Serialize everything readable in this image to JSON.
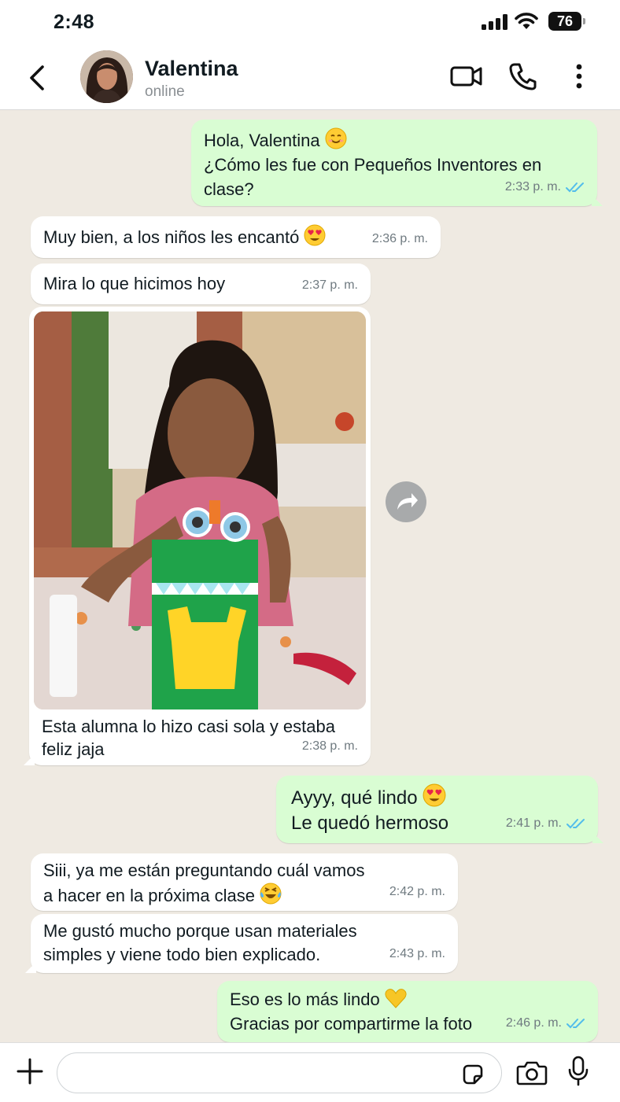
{
  "status_bar": {
    "time": "2:48",
    "battery": "76"
  },
  "header": {
    "contact_name": "Valentina",
    "contact_status": "online"
  },
  "messages": [
    {
      "from": "me",
      "lines": [
        "Hola, Valentina",
        "¿Cómo les fue con Pequeños Inventores en clase?"
      ],
      "time": "2:33 p. m.",
      "ticks": "read"
    },
    {
      "from": "contact",
      "lines": [
        "Muy bien, a los niños les encantó"
      ],
      "time": "2:36 p. m."
    },
    {
      "from": "contact",
      "lines": [
        "Mira lo que hicimos hoy"
      ],
      "time": "2:37 p. m."
    },
    {
      "from": "contact",
      "type": "image",
      "caption_lines": [
        "Esta alumna lo hizo casi sola y estaba",
        "feliz jaja"
      ],
      "time": "2:38 p. m."
    },
    {
      "from": "me",
      "lines": [
        "Ayyy, qué lindo",
        "Le quedó hermoso"
      ],
      "time": "2:41 p. m.",
      "ticks": "read"
    },
    {
      "from": "contact",
      "lines": [
        "Siii, ya me están preguntando cuál vamos",
        "a hacer en la próxima clase"
      ],
      "time": "2:42 p. m."
    },
    {
      "from": "contact",
      "lines": [
        "Me gustó mucho porque usan materiales",
        "simples y viene todo bien explicado."
      ],
      "time": "2:43 p. m."
    },
    {
      "from": "me",
      "lines": [
        "Eso es lo más lindo",
        "Gracias por compartirme la foto"
      ],
      "time": "2:46 p. m.",
      "ticks": "read"
    }
  ],
  "composer": {
    "placeholder": ""
  },
  "colors": {
    "incoming": "#ffffff",
    "outgoing": "#d9fdd3",
    "background": "#efeae2",
    "read_ticks": "#53bdeb"
  }
}
